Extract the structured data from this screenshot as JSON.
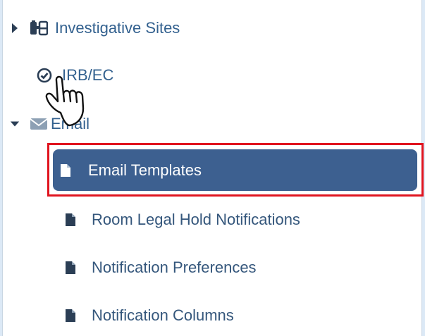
{
  "tree": {
    "investigative_sites": {
      "label": "Investigative Sites",
      "icon": "binoculars-icon",
      "caret": "caret-right-icon"
    },
    "irb_ec": {
      "label": "IRB/EC",
      "icon": "check-circle-icon"
    },
    "email": {
      "label": "Email",
      "icon": "envelope-icon",
      "caret": "caret-down-icon"
    },
    "email_children": [
      {
        "label": "Email Templates",
        "icon": "file-icon",
        "selected": true
      },
      {
        "label": "Room Legal Hold Notifications",
        "icon": "file-icon"
      },
      {
        "label": "Notification Preferences",
        "icon": "file-icon"
      },
      {
        "label": "Notification Columns",
        "icon": "file-icon"
      }
    ]
  },
  "colors": {
    "link": "#33618f",
    "selected_bg": "#3d6090",
    "highlight_border": "#e0141f",
    "page_bg": "#dce9f6"
  },
  "cursor": "hand-pointer-icon"
}
